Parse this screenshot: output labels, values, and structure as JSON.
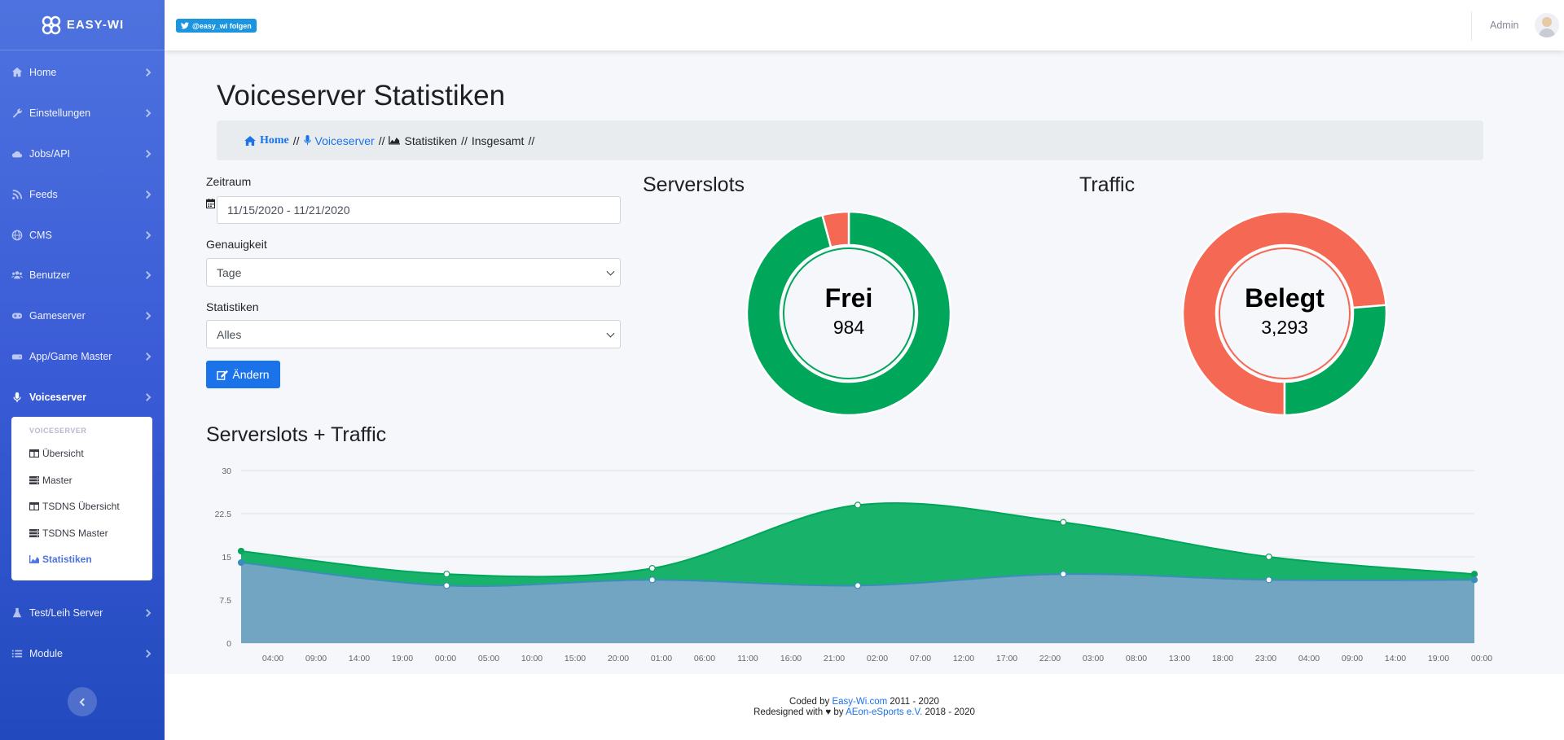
{
  "app": {
    "brand": "EASY-WI"
  },
  "sidebar": {
    "items": [
      {
        "label": "Home",
        "icon": "home-icon"
      },
      {
        "label": "Einstellungen",
        "icon": "wrench-icon"
      },
      {
        "label": "Jobs/API",
        "icon": "cloud-icon"
      },
      {
        "label": "Feeds",
        "icon": "rss-icon"
      },
      {
        "label": "CMS",
        "icon": "globe-icon"
      },
      {
        "label": "Benutzer",
        "icon": "users-icon"
      },
      {
        "label": "Gameserver",
        "icon": "gamepad-icon"
      },
      {
        "label": "App/Game Master",
        "icon": "hdd-icon"
      },
      {
        "label": "Voiceserver",
        "icon": "microphone-icon"
      },
      {
        "label": "Test/Leih Server",
        "icon": "flask-icon"
      },
      {
        "label": "Module",
        "icon": "list-icon"
      }
    ],
    "submenu": {
      "heading": "VOICESERVER",
      "items": [
        {
          "label": "Übersicht",
          "icon": "table-icon"
        },
        {
          "label": "Master",
          "icon": "server-icon"
        },
        {
          "label": "TSDNS Übersicht",
          "icon": "table-icon"
        },
        {
          "label": "TSDNS Master",
          "icon": "server-icon"
        },
        {
          "label": "Statistiken",
          "icon": "area-chart-icon"
        }
      ]
    }
  },
  "topbar": {
    "twitter_label": "@easy_wi folgen",
    "user_name": "Admin"
  },
  "page": {
    "title": "Voiceserver Statistiken"
  },
  "breadcrumb": {
    "home": "Home",
    "sep": "//",
    "voiceserver": "Voiceserver",
    "stats": "Statistiken",
    "total": "Insgesamt"
  },
  "form": {
    "zeitraum_label": "Zeitraum",
    "zeitraum_value": "11/15/2020 - 11/21/2020",
    "genauigkeit_label": "Genauigkeit",
    "genauigkeit_value": "Tage",
    "statistiken_label": "Statistiken",
    "statistiken_value": "Alles",
    "submit_label": "Ändern"
  },
  "sections": {
    "slots_title": "Serverslots",
    "traffic_title": "Traffic",
    "combined_title": "Serverslots + Traffic"
  },
  "colors": {
    "green": "#00a65a",
    "red": "#f56954",
    "blue_area": "#6d9fc0",
    "accent": "#1a73e8"
  },
  "chart_data": [
    {
      "type": "pie",
      "title": "Serverslots",
      "center_label": "Frei",
      "center_value": "984",
      "slices": [
        {
          "label": "Frei",
          "value": 984,
          "color": "#00a65a"
        },
        {
          "label": "Belegt",
          "value": 43,
          "color": "#f56954"
        }
      ]
    },
    {
      "type": "pie",
      "title": "Traffic",
      "center_label": "Belegt",
      "center_value": "3,293",
      "slices": [
        {
          "label": "Belegt",
          "value": 3293,
          "color": "#f56954"
        },
        {
          "label": "Frei",
          "value": 1176,
          "color": "#00a65a"
        }
      ]
    },
    {
      "type": "area",
      "title": "Serverslots + Traffic",
      "ylim": [
        0,
        30
      ],
      "yticks": [
        "0",
        "7.5",
        "15",
        "22.5",
        "30"
      ],
      "xticks": [
        "04:00",
        "09:00",
        "14:00",
        "19:00",
        "00:00",
        "05:00",
        "10:00",
        "15:00",
        "20:00",
        "01:00",
        "06:00",
        "11:00",
        "16:00",
        "21:00",
        "02:00",
        "07:00",
        "12:00",
        "17:00",
        "22:00",
        "03:00",
        "08:00",
        "13:00",
        "18:00",
        "23:00",
        "04:00",
        "09:00",
        "14:00",
        "19:00",
        "00:00"
      ],
      "x": [
        0,
        1,
        2,
        3,
        4,
        5,
        6
      ],
      "series": [
        {
          "values": [
            16,
            12,
            13,
            24,
            21,
            15,
            12
          ],
          "color": "#00a65a"
        },
        {
          "values": [
            14,
            10,
            11,
            10,
            12,
            11,
            11
          ],
          "color": "#6d9fc0"
        }
      ]
    }
  ],
  "footer": {
    "coded_prefix": "Coded by",
    "coded_link": "Easy-Wi.com",
    "coded_suffix": "2011 - 2020",
    "redesign_prefix": "Redesigned with ♥ by",
    "redesign_link": "AEon-eSports e.V.",
    "redesign_suffix": "2018 - 2020"
  }
}
